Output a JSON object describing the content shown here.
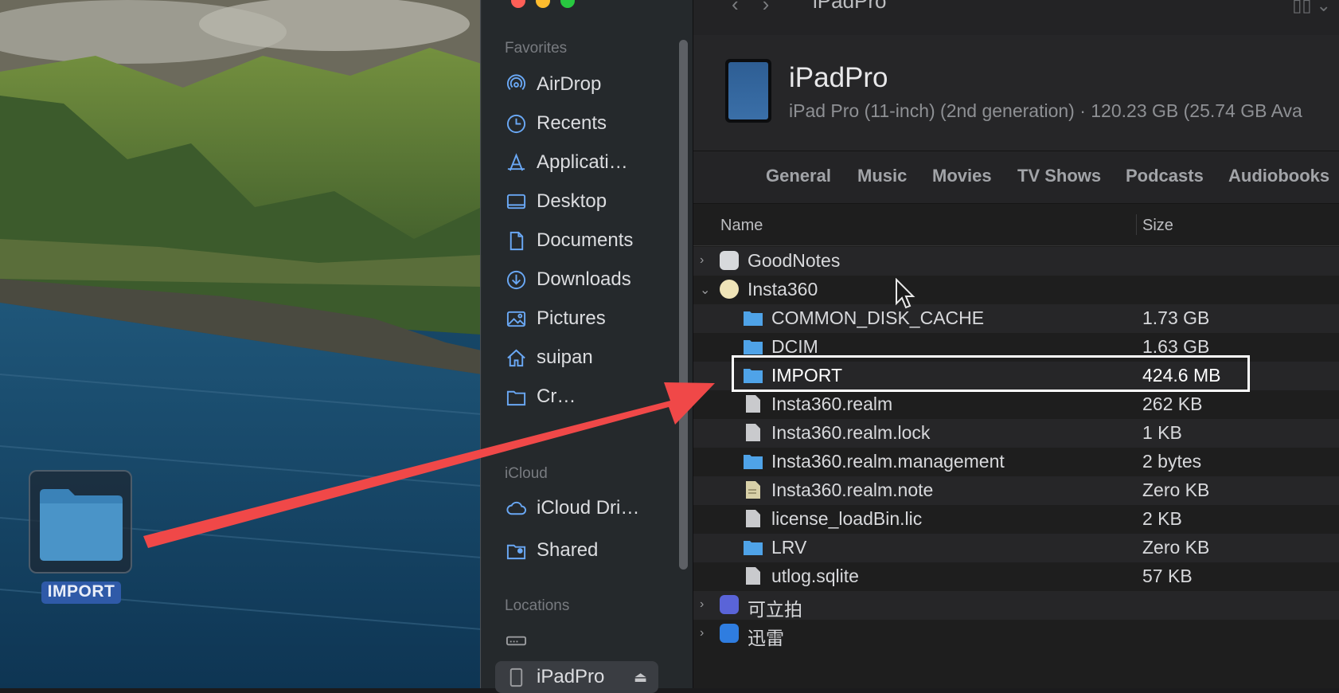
{
  "desktop": {
    "folder_label": "IMPORT"
  },
  "sidebar": {
    "favorites_header": "Favorites",
    "favorites": [
      {
        "label": "AirDrop",
        "icon": "airdrop-icon"
      },
      {
        "label": "Recents",
        "icon": "clock-icon"
      },
      {
        "label": "Applicati…",
        "icon": "applications-icon"
      },
      {
        "label": "Desktop",
        "icon": "desktop-icon"
      },
      {
        "label": "Documents",
        "icon": "document-icon"
      },
      {
        "label": "Downloads",
        "icon": "download-icon"
      },
      {
        "label": "Pictures",
        "icon": "pictures-icon"
      },
      {
        "label": "suipan",
        "icon": "home-icon"
      },
      {
        "label": "Cr…",
        "icon": "folder-icon"
      }
    ],
    "icloud_header": "iCloud",
    "icloud": [
      {
        "label": "iCloud Dri…",
        "icon": "cloud-icon"
      },
      {
        "label": "Shared",
        "icon": "shared-folder-icon"
      }
    ],
    "locations_header": "Locations",
    "locations": [
      {
        "label": "",
        "icon": "drive-icon"
      },
      {
        "label": "iPadPro",
        "icon": "ipad-icon",
        "eject": "⏏"
      }
    ]
  },
  "toolbar": {
    "back": "‹",
    "forward": "›",
    "title": "iPadPro"
  },
  "device": {
    "name": "iPadPro",
    "info": "iPad Pro (11-inch) (2nd generation) · 120.23 GB (25.74 GB Ava"
  },
  "tabs": [
    "General",
    "Music",
    "Movies",
    "TV Shows",
    "Podcasts",
    "Audiobooks"
  ],
  "columns": {
    "name": "Name",
    "size": "Size"
  },
  "rows": [
    {
      "name": "GoodNotes",
      "size": "",
      "level": 0,
      "chevron": "›",
      "icon": "goodnotes-app-icon"
    },
    {
      "name": "Insta360",
      "size": "",
      "level": 0,
      "chevron": "⌄",
      "icon": "insta360-app-icon"
    },
    {
      "name": "COMMON_DISK_CACHE",
      "size": "1.73 GB",
      "level": 1,
      "icon": "folder-icon"
    },
    {
      "name": "DCIM",
      "size": "1.63 GB",
      "level": 1,
      "icon": "folder-icon"
    },
    {
      "name": "IMPORT",
      "size": "424.6 MB",
      "level": 1,
      "icon": "folder-icon"
    },
    {
      "name": "Insta360.realm",
      "size": "262 KB",
      "level": 1,
      "icon": "file-icon"
    },
    {
      "name": "Insta360.realm.lock",
      "size": "1 KB",
      "level": 1,
      "icon": "file-icon"
    },
    {
      "name": "Insta360.realm.management",
      "size": "2 bytes",
      "level": 1,
      "icon": "folder-icon"
    },
    {
      "name": "Insta360.realm.note",
      "size": "Zero KB",
      "level": 1,
      "icon": "note-file-icon"
    },
    {
      "name": "license_loadBin.lic",
      "size": "2 KB",
      "level": 1,
      "icon": "file-icon"
    },
    {
      "name": "LRV",
      "size": "Zero KB",
      "level": 1,
      "icon": "folder-icon"
    },
    {
      "name": "utlog.sqlite",
      "size": "57 KB",
      "level": 1,
      "icon": "file-icon"
    },
    {
      "name": "可立拍",
      "size": "",
      "level": 0,
      "chevron": "›",
      "icon": "clips-app-icon"
    },
    {
      "name": "迅雷",
      "size": "",
      "level": 0,
      "chevron": "›",
      "icon": "xunlei-app-icon"
    }
  ],
  "colors": {
    "accent": "#6aa8f5",
    "folder": "#4fa3e8",
    "arrow": "#f04848",
    "highlight": "#ffffff",
    "traffic": [
      "#fe5f57",
      "#febc2e",
      "#28c840"
    ]
  }
}
